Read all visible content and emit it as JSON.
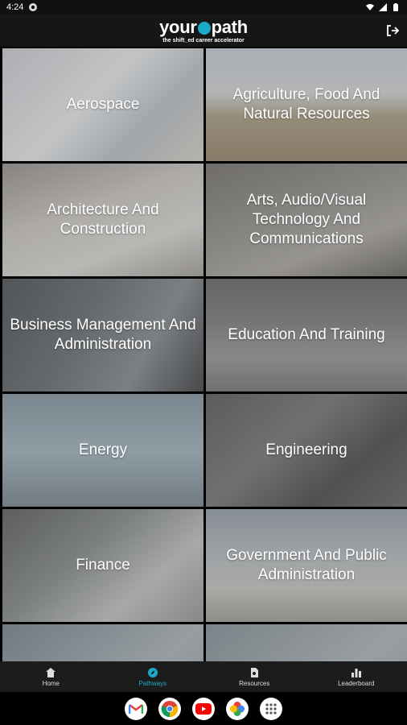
{
  "status_bar": {
    "time": "4:24"
  },
  "header": {
    "logo_left": "your",
    "logo_right": "path",
    "tagline": "the shift_ed career accelerator"
  },
  "pathways": [
    {
      "label": "Aerospace"
    },
    {
      "label": "Agriculture, Food And Natural Resources"
    },
    {
      "label": "Architecture And Construction"
    },
    {
      "label": "Arts, Audio/Visual Technology And Communications"
    },
    {
      "label": "Business Management And Administration"
    },
    {
      "label": "Education And Training"
    },
    {
      "label": "Energy"
    },
    {
      "label": "Engineering"
    },
    {
      "label": "Finance"
    },
    {
      "label": "Government And Public Administration"
    }
  ],
  "nav": {
    "home": "Home",
    "pathways": "Pathways",
    "resources": "Resources",
    "leaderboard": "Leaderboard"
  },
  "colors": {
    "accent": "#1ba9c9",
    "header_bg": "#161616",
    "nav_bg": "#1c1c1c"
  },
  "dock_apps": [
    "gmail-icon",
    "chrome-icon",
    "youtube-icon",
    "photos-icon",
    "app-drawer-icon"
  ]
}
